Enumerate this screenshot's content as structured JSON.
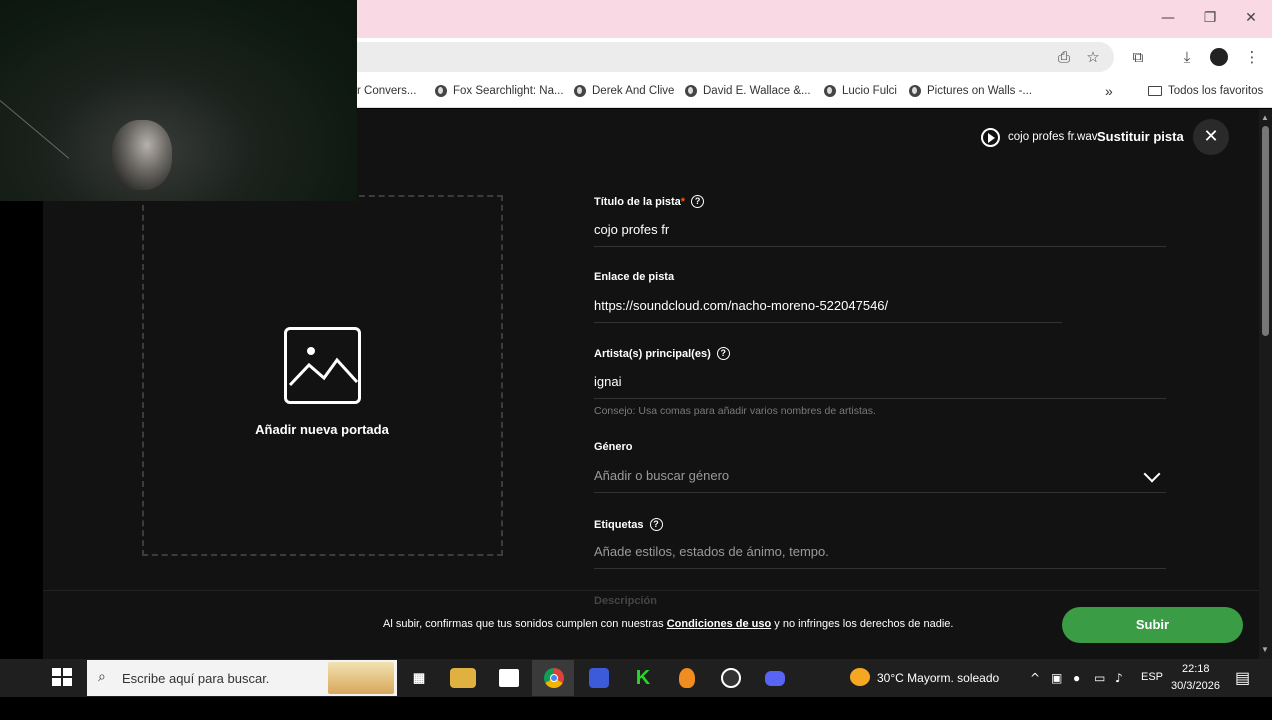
{
  "browser": {
    "window_controls": {
      "minimize": "—",
      "restore": "❐",
      "close": "✕"
    },
    "bookmarks": [
      {
        "label": "r Convers...",
        "icon": "globe-icon"
      },
      {
        "label": "Fox Searchlight: Na...",
        "icon": "globe-icon"
      },
      {
        "label": "Derek And Clive",
        "icon": "globe-icon"
      },
      {
        "label": "David E. Wallace &...",
        "icon": "globe-icon"
      },
      {
        "label": "Lucio Fulci",
        "icon": "globe-icon"
      },
      {
        "label": "Pictures on Walls -...",
        "icon": "globe-icon"
      }
    ],
    "bookmarks_overflow": "»",
    "all_bookmarks": "Todos los favoritos"
  },
  "header": {
    "file_name": "cojo profes fr.wav",
    "replace_label": "Sustituir pista",
    "close_label": "✕"
  },
  "cover": {
    "label": "Añadir nueva portada"
  },
  "form": {
    "title": {
      "label": "Título de la pista",
      "required_mark": "*",
      "value": "cojo profes fr"
    },
    "link": {
      "label": "Enlace de pista",
      "value": "https://soundcloud.com/nacho-moreno-522047546/"
    },
    "artists": {
      "label": "Artista(s) principal(es)",
      "value": "ignai",
      "hint": "Consejo: Usa comas para añadir varios nombres de artistas."
    },
    "genre": {
      "label": "Género",
      "placeholder": "Añadir o buscar género"
    },
    "tags": {
      "label": "Etiquetas",
      "placeholder": "Añade estilos, estados de ánimo, tempo."
    },
    "description": {
      "label": "Descripción"
    }
  },
  "footer": {
    "terms_prefix": "Al subir, confirmas que tus sonidos cumplen con nuestras ",
    "terms_link": "Condiciones de uso",
    "terms_suffix": " y no infringes los derechos de nadie.",
    "upload_label": "Subir"
  },
  "taskbar": {
    "search_placeholder": "Escribe aquí para buscar.",
    "weather": "30°C  Mayorm. soleado",
    "language": "ESP",
    "time": "22:18",
    "date": "30/3/2026"
  },
  "colors": {
    "accent_green": "#3a9c45",
    "required": "#ff5500",
    "page_bg": "#121212"
  }
}
